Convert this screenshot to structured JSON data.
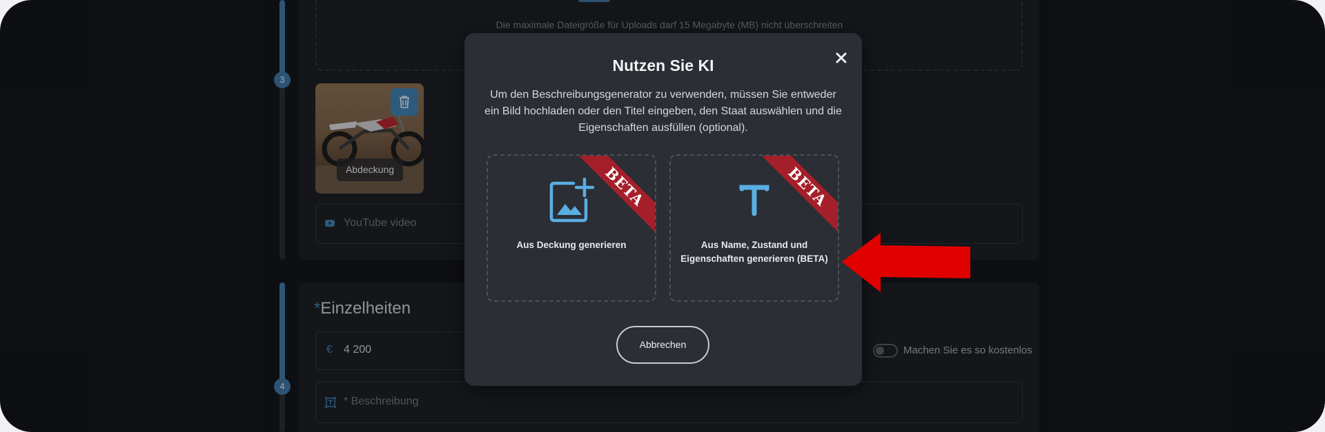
{
  "upload": {
    "note": "Die maximale Dateigröße für Uploads darf 15 Megabyte (MB) nicht überschreiten",
    "cover_label": "Abdeckung"
  },
  "steps": {
    "photos_number": "3",
    "details_number": "4"
  },
  "youtube": {
    "placeholder": "YouTube video"
  },
  "details": {
    "required_mark": "*",
    "title": "Einzelheiten",
    "currency_symbol": "€",
    "price": "4 200",
    "free_label": "Machen Sie es so kostenlos",
    "description_placeholder": "* Beschreibung"
  },
  "modal": {
    "title": "Nutzen Sie KI",
    "description": "Um den Beschreibungsgenerator zu verwenden, müssen Sie entweder ein Bild hochladen oder den Titel eingeben, den Staat auswählen und die Eigenschaften ausfüllen (optional).",
    "options": [
      {
        "icon": "image-add-icon",
        "label": "Aus Deckung generieren",
        "badge": "BETA"
      },
      {
        "icon": "text-icon",
        "label": "Aus Name, Zustand und Eigenschaften generieren (BETA)",
        "badge": "BETA"
      }
    ],
    "cancel_label": "Abbrechen"
  },
  "colors": {
    "accent": "#3f7fae",
    "modal_bg": "#2b2e34",
    "page_bg": "#14161b",
    "badge": "#a51f2b",
    "arrow": "#e00000"
  }
}
